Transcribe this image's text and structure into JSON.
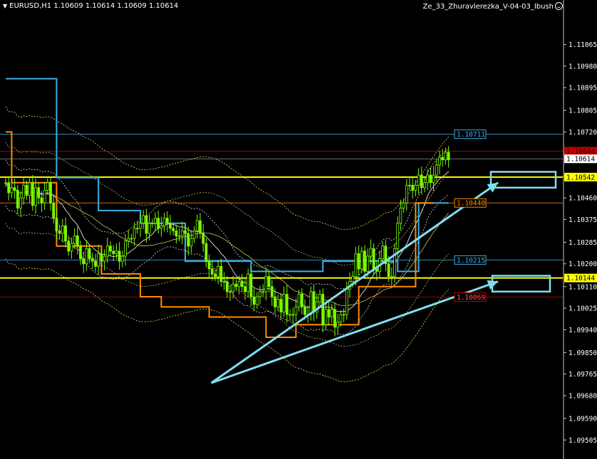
{
  "header": {
    "symbol_info": "EURUSD,H1  1.10609 1.10614 1.10609 1.10614",
    "indicator_name": "Ze_33_Zhuravlerezka_V-04-03_Ibush"
  },
  "colors": {
    "background": "#000000",
    "candle": "#7CFC00",
    "cyan_line": "#3AB0E8",
    "orange_line": "#FF8C00",
    "yellow_level": "#FFFF00",
    "red_level": "#C00000",
    "arrow": "#7FDFEF"
  },
  "chart_data": {
    "type": "line",
    "axis": {
      "ylim": [
        1.0943,
        1.1119
      ],
      "ticks": [
        "1.11065",
        "1.10980",
        "1.10895",
        "1.10805",
        "1.10720",
        "1.10635",
        "1.10545",
        "1.10460",
        "1.10375",
        "1.10285",
        "1.10200",
        "1.10110",
        "1.10025",
        "1.09940",
        "1.09850",
        "1.09765",
        "1.09680",
        "1.09590",
        "1.09505"
      ],
      "tick_values": [
        1.11065,
        1.1098,
        1.10895,
        1.10805,
        1.1072,
        1.10635,
        1.10545,
        1.1046,
        1.10375,
        1.10285,
        1.102,
        1.1011,
        1.10025,
        1.0994,
        1.0985,
        1.09765,
        1.0968,
        1.0959,
        1.09505
      ]
    },
    "price_levels": [
      {
        "label": "1.10711",
        "value": 1.10711,
        "style": "box-cyan"
      },
      {
        "label": "1.10644",
        "value": 1.10644,
        "style": "axis-red"
      },
      {
        "label": "1.10614",
        "value": 1.10614,
        "style": "axis-white"
      },
      {
        "label": "1.10542",
        "value": 1.10542,
        "style": "axis-yellow"
      },
      {
        "label": "1.10440",
        "value": 1.1044,
        "style": "box-orange"
      },
      {
        "label": "1.10215",
        "value": 1.10215,
        "style": "box-cyan"
      },
      {
        "label": "1.10144",
        "value": 1.10144,
        "style": "axis-yellow"
      },
      {
        "label": "1.10069",
        "value": 1.10069,
        "style": "box-red"
      }
    ],
    "series": [
      {
        "style": "close",
        "values": [
          1.1052,
          1.1048,
          1.105,
          1.1049,
          1.1042,
          1.1046,
          1.1051,
          1.1047,
          1.1052,
          1.1043,
          1.105,
          1.1046,
          1.1044,
          1.1049,
          1.1052,
          1.1044,
          1.1038,
          1.1033,
          1.1032,
          1.1035,
          1.1029,
          1.1025,
          1.1028,
          1.1031,
          1.1027,
          1.1022,
          1.102,
          1.1026,
          1.1022,
          1.1021,
          1.1019,
          1.1024,
          1.1021,
          1.1023,
          1.1027,
          1.1025,
          1.1024,
          1.1025,
          1.1021,
          1.1023,
          1.1029,
          1.103,
          1.103,
          1.1034,
          1.1034,
          1.1036,
          1.1039,
          1.1032,
          1.1036,
          1.1036,
          1.1038,
          1.1034,
          1.1035,
          1.1038,
          1.1036,
          1.1034,
          1.1033,
          1.1031,
          1.1031,
          1.1033,
          1.1032,
          1.1027,
          1.103,
          1.1033,
          1.1037,
          1.1032,
          1.1028,
          1.1021,
          1.1018,
          1.1016,
          1.1015,
          1.1019,
          1.1013,
          1.1013,
          1.1009,
          1.1009,
          1.1012,
          1.1011,
          1.1013,
          1.1011,
          1.1009,
          1.1016,
          1.1007,
          1.1004,
          1.1007,
          1.1009,
          1.1009,
          1.1015,
          1.1011,
          1.1007,
          1.1003,
          1.1006,
          1.1001,
          1.1008,
          1.1,
          1.1,
          1.1,
          1.1003,
          1.1008,
          1.1003,
          1.1,
          1.1,
          1.1009,
          1.1001,
          1.1005,
          1.1008,
          1.0996,
          1.1002,
          1.0999,
          1.1002,
          1.0995,
          1.0997,
          1.1,
          1.1,
          1.101,
          1.1013,
          1.1015,
          1.1024,
          1.1018,
          1.1025,
          1.1017,
          1.1023,
          1.1026,
          1.1018,
          1.1017,
          1.1022,
          1.1027,
          1.102,
          1.1015,
          1.1015,
          1.1026,
          1.1036,
          1.1042,
          1.1044,
          1.1051,
          1.1051,
          1.1049,
          1.1051,
          1.1055,
          1.105,
          1.1052,
          1.1055,
          1.1052,
          1.1055,
          1.1059,
          1.1062,
          1.1061,
          1.1064,
          1.1061
        ]
      },
      {
        "style": "cyan_step",
        "name": "",
        "values": [
          [
            0,
            1.1093
          ],
          [
            17,
            1.1093
          ],
          [
            17,
            1.1054
          ],
          [
            31,
            1.1054
          ],
          [
            31,
            1.1041
          ],
          [
            45,
            1.1041
          ],
          [
            45,
            1.1036
          ],
          [
            60,
            1.1036
          ],
          [
            60,
            1.1021
          ],
          [
            82,
            1.1021
          ],
          [
            82,
            1.1017
          ],
          [
            106,
            1.1017
          ],
          [
            106,
            1.1021
          ],
          [
            131,
            1.1021
          ],
          [
            131,
            1.1017
          ],
          [
            138,
            1.1017
          ],
          [
            138,
            1.1044
          ],
          [
            148,
            1.1044
          ]
        ]
      },
      {
        "style": "orange_step",
        "name": "",
        "values": [
          [
            0,
            1.1072
          ],
          [
            2,
            1.1072
          ],
          [
            2,
            1.1052
          ],
          [
            17,
            1.1052
          ],
          [
            17,
            1.1027
          ],
          [
            32,
            1.1027
          ],
          [
            32,
            1.1016
          ],
          [
            45,
            1.1016
          ],
          [
            45,
            1.1007
          ],
          [
            52,
            1.1007
          ],
          [
            52,
            1.1003
          ],
          [
            68,
            1.1003
          ],
          [
            68,
            1.0999
          ],
          [
            87,
            1.0999
          ],
          [
            87,
            1.0991
          ],
          [
            97,
            1.0991
          ],
          [
            97,
            1.0996
          ],
          [
            118,
            1.0996
          ],
          [
            118,
            1.1011
          ],
          [
            137,
            1.1011
          ],
          [
            137,
            1.1044
          ],
          [
            143,
            1.1044
          ]
        ]
      }
    ],
    "arrows": [
      {
        "from": [
          43,
          1.0973
        ],
        "to": [
          105,
          1.1052
        ]
      },
      {
        "from": [
          43,
          1.0973
        ],
        "to": [
          105,
          1.1013
        ]
      }
    ],
    "target_boxes": [
      {
        "x0": 104,
        "x1": 117,
        "y0": 1.1052,
        "y1": 1.1056
      },
      {
        "x0": 104,
        "x1": 116,
        "y0": 1.1011,
        "y1": 1.1015
      }
    ]
  }
}
